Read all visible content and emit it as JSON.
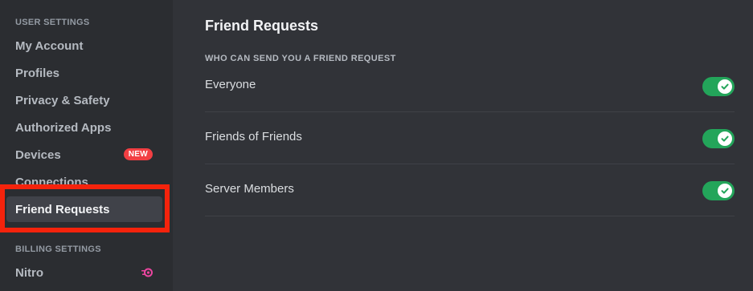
{
  "sidebar": {
    "user_settings_header": "USER SETTINGS",
    "items": [
      {
        "label": "My Account"
      },
      {
        "label": "Profiles"
      },
      {
        "label": "Privacy & Safety"
      },
      {
        "label": "Authorized Apps"
      },
      {
        "label": "Devices",
        "badge": "NEW"
      },
      {
        "label": "Connections"
      },
      {
        "label": "Friend Requests",
        "selected": true
      }
    ],
    "billing_settings_header": "BILLING SETTINGS",
    "billing_items": [
      {
        "label": "Nitro",
        "icon": "nitro-icon"
      }
    ]
  },
  "main": {
    "title": "Friend Requests",
    "section_header": "WHO CAN SEND YOU A FRIEND REQUEST",
    "options": [
      {
        "label": "Everyone",
        "enabled": true
      },
      {
        "label": "Friends of Friends",
        "enabled": true
      },
      {
        "label": "Server Members",
        "enabled": true
      }
    ]
  },
  "colors": {
    "toggle_on": "#23a55a",
    "badge_new": "#f23f43",
    "highlight": "#f5230c",
    "nitro": "#eb459f"
  }
}
